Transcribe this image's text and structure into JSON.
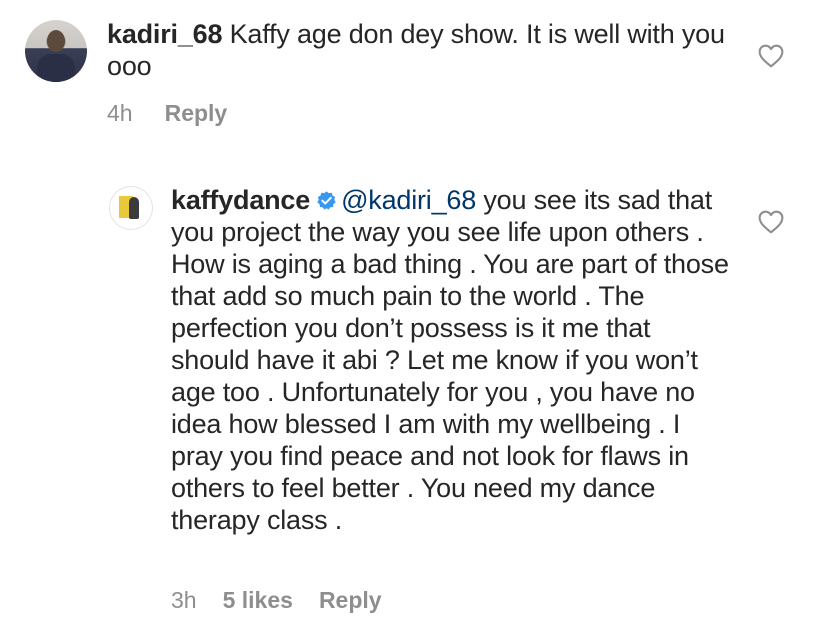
{
  "comments": [
    {
      "username": "kadiri_68",
      "text": " Kaffy age don dey show. It is well with you ooo",
      "time": "4h",
      "reply_label": "Reply"
    },
    {
      "username": "kaffydance",
      "verified": true,
      "mention": "@kadiri_68",
      "text": " you see its sad that you project the way you see life upon others . How is aging a bad thing . You are part of those that  add so much pain to the world . The perfection you don’t possess is it me that should have it abi ? Let me know if you won’t age too . Unfortunately for you , you have no  idea how blessed I am with my wellbeing . I pray you find peace and not look for flaws in others to feel better . You need  my dance therapy class .",
      "time": "3h",
      "likes": "5 likes",
      "reply_label": "Reply"
    }
  ],
  "icons": {
    "like": "heart-outline-icon",
    "verified": "verified-badge-icon"
  },
  "colors": {
    "text": "#262626",
    "muted": "#8e8e8e",
    "mention": "#00376b",
    "verified": "#3897f0"
  }
}
